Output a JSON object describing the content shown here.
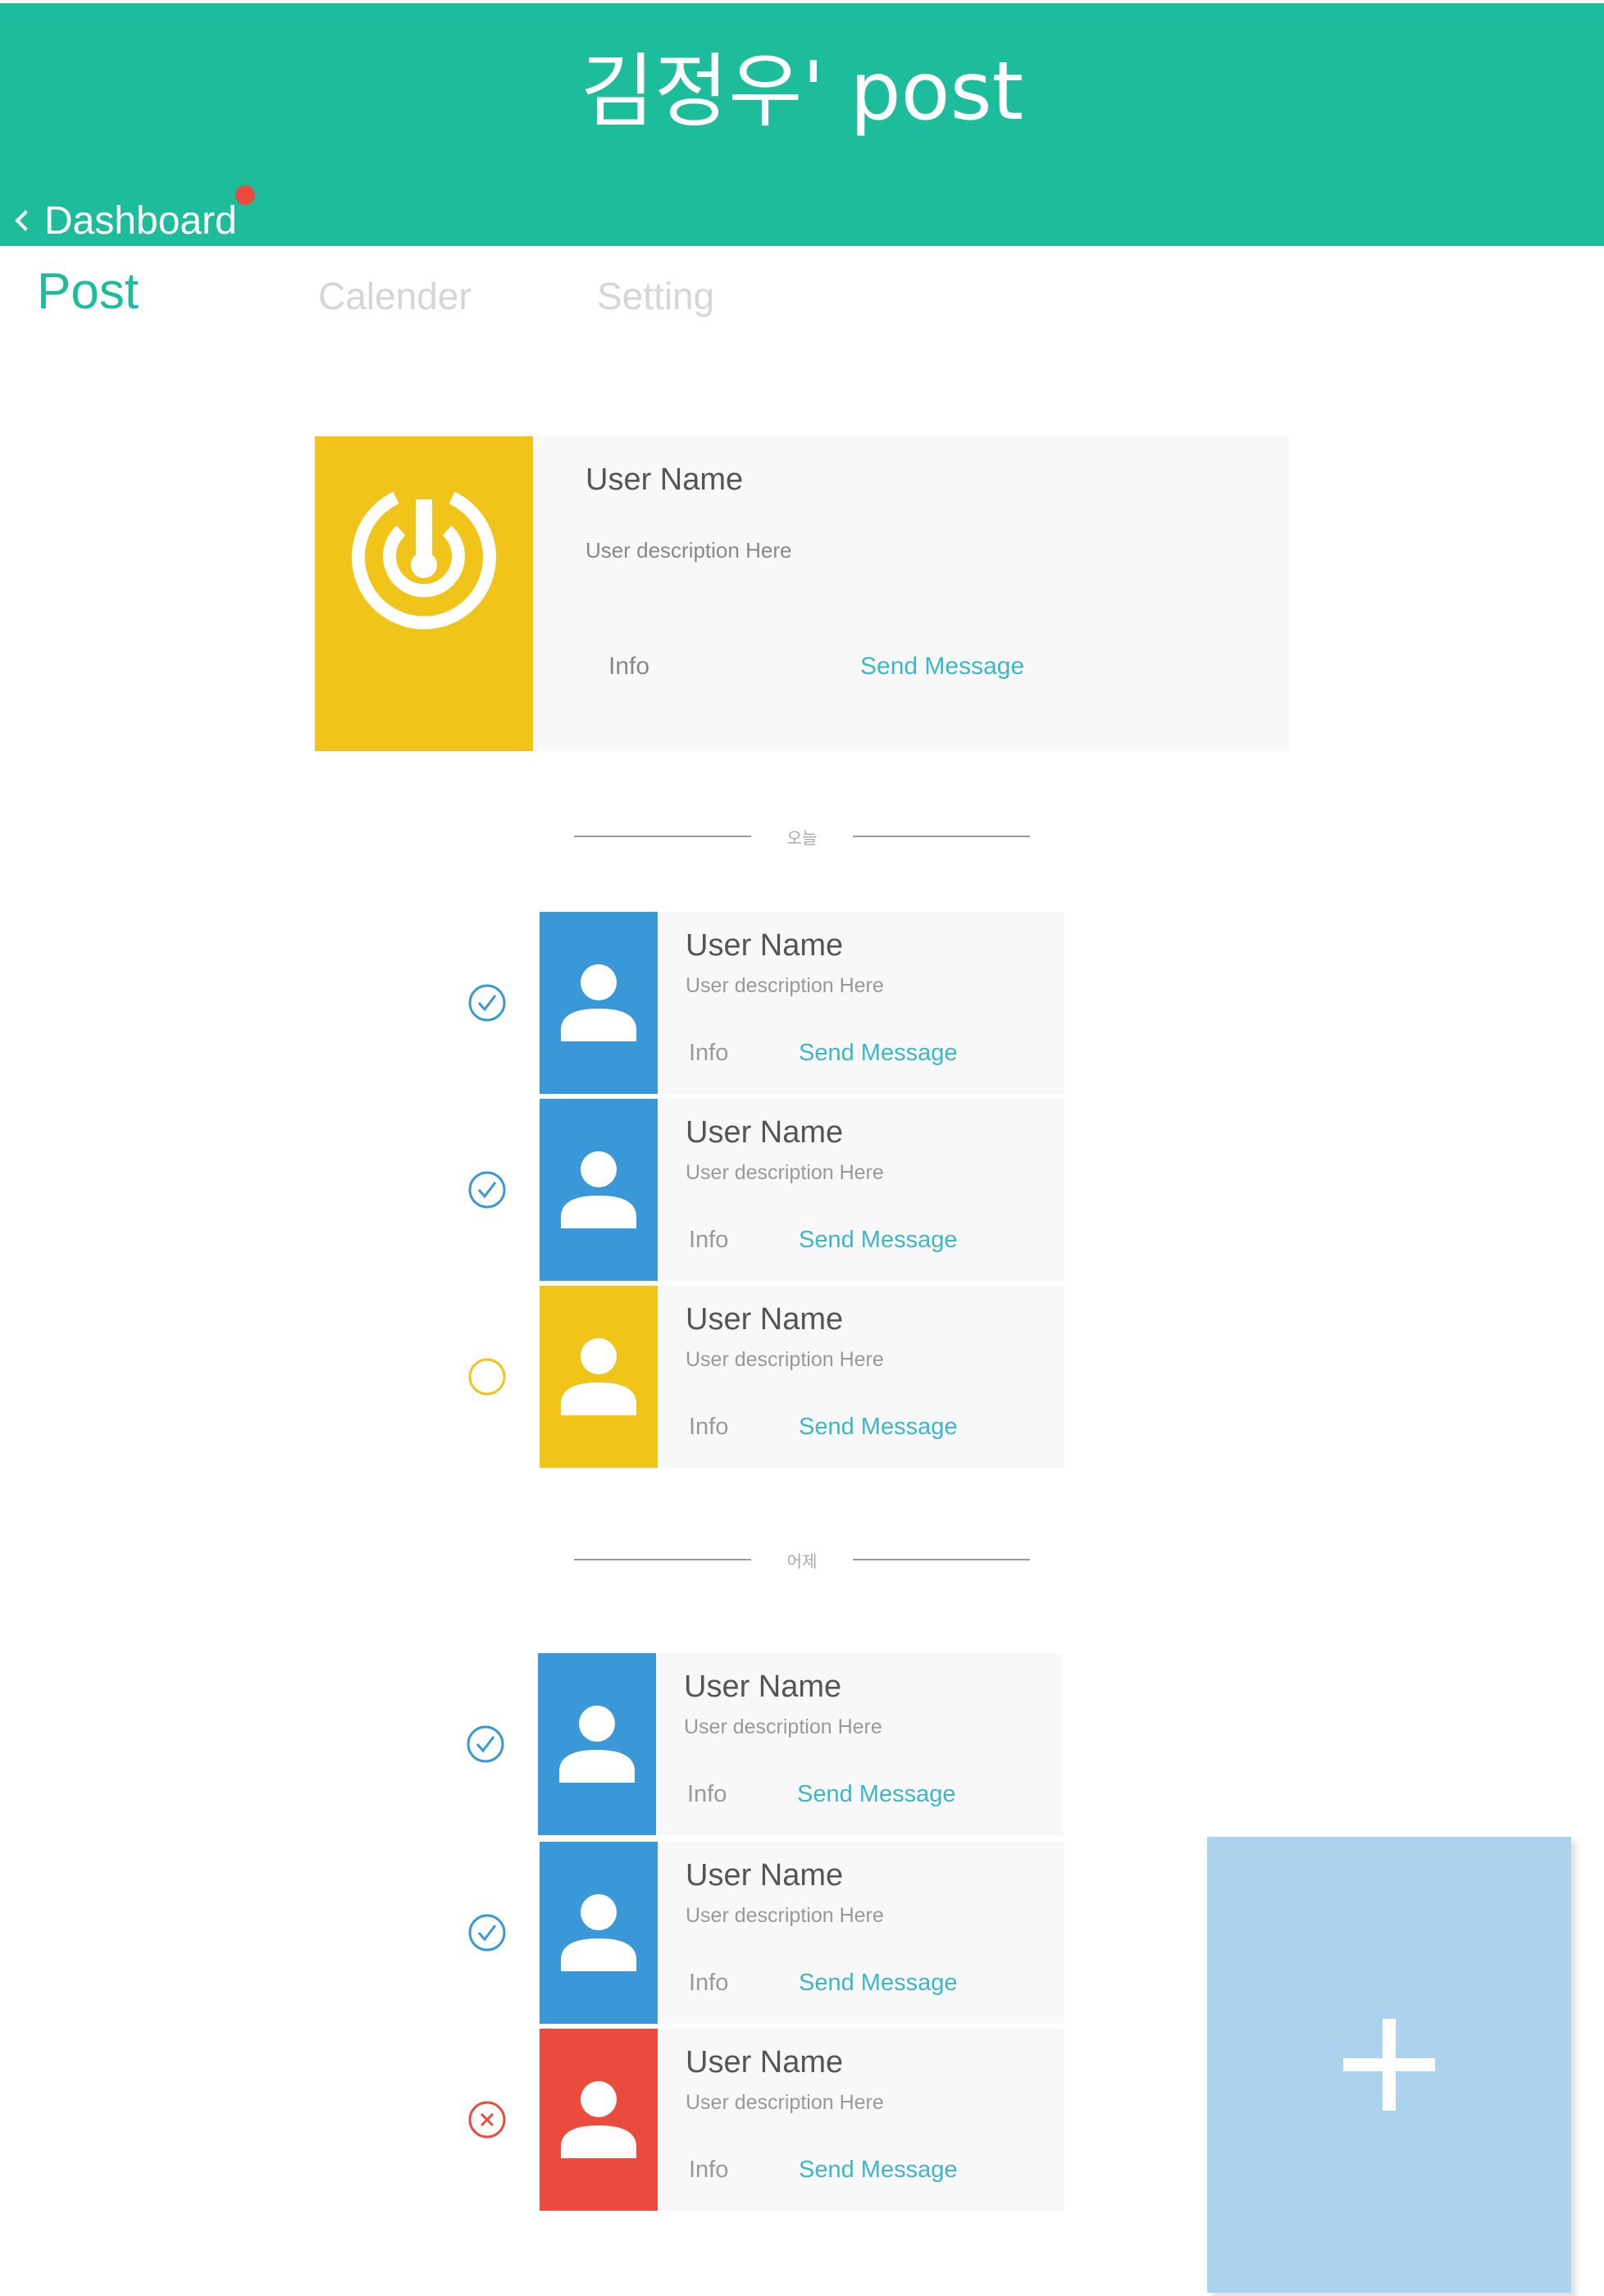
{
  "header": {
    "title": "김정우' post",
    "back_label": "Dashboard",
    "accent_color": "#1dbd9b",
    "notification_color": "#e94b3c"
  },
  "tabs": [
    {
      "label": "Post",
      "active": true
    },
    {
      "label": "Calender",
      "active": false
    },
    {
      "label": "Setting",
      "active": false
    }
  ],
  "profile": {
    "name": "User Name",
    "description": "User description Here",
    "info_label": "Info",
    "send_label": "Send Message",
    "logo_icon": "power-target-icon",
    "logo_color": "#f0c419"
  },
  "sections": [
    {
      "label": "오늘",
      "items": [
        {
          "name": "User Name",
          "description": "User description Here",
          "info_label": "Info",
          "send_label": "Send Message",
          "status": "checked",
          "color": "#3a98d8"
        },
        {
          "name": "User Name",
          "description": "User description Here",
          "info_label": "Info",
          "send_label": "Send Message",
          "status": "checked",
          "color": "#3a98d8"
        },
        {
          "name": "User Name",
          "description": "User description Here",
          "info_label": "Info",
          "send_label": "Send Message",
          "status": "pending",
          "color": "#f0c419"
        }
      ]
    },
    {
      "label": "어제",
      "items": [
        {
          "name": "User Name",
          "description": "User description Here",
          "info_label": "Info",
          "send_label": "Send Message",
          "status": "checked",
          "color": "#3a98d8"
        },
        {
          "name": "User Name",
          "description": "User description Here",
          "info_label": "Info",
          "send_label": "Send Message",
          "status": "checked",
          "color": "#3a98d8"
        },
        {
          "name": "User Name",
          "description": "User description Here",
          "info_label": "Info",
          "send_label": "Send Message",
          "status": "rejected",
          "color": "#e94b3c"
        }
      ]
    }
  ],
  "fab": {
    "icon": "plus-icon",
    "color": "#abd3ee"
  }
}
